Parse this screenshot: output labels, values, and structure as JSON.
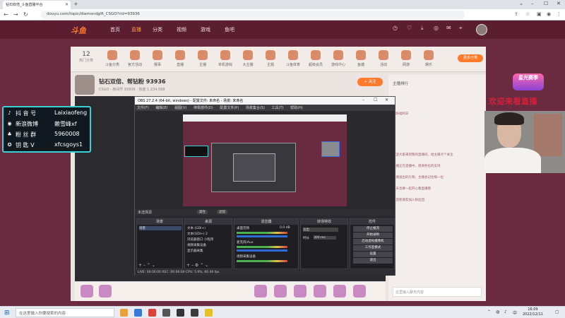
{
  "browser": {
    "tab_title": "钻石双倍_斗鱼直播平台",
    "url": "douyu.com/topic/diamondgift_CSGO?rid=93936"
  },
  "site": {
    "logo": "斗鱼",
    "nav": [
      "首页",
      "直播",
      "分类",
      "视频",
      "游戏",
      "鱼吧"
    ]
  },
  "category": {
    "count": "12",
    "count_label": "热门分类",
    "items": [
      "斗鱼分类",
      "官方活动",
      "赛事",
      "直播",
      "主播",
      "单机游戏",
      "大主播",
      "主题",
      "斗鱼体育",
      "超级会员",
      "游戏中心",
      "鱼塘",
      "活动",
      "网游",
      "娱乐"
    ],
    "button": "更多分类"
  },
  "streamer": {
    "title": "钻石双倍、帮钻粉 93936",
    "sub": "CSGO  · 房间号 93936  · 热度 1,234,568",
    "follow": "+ 关注"
  },
  "sidebar": {
    "rank_label": "主播排行",
    "chat_lines": [
      "钻粉福利日",
      "欢迎大家来到我的直播间，给主播点个关注",
      "主播正在直播中，感谢各位的支持",
      "感谢送出的礼物，主播会记住每一位",
      "今天也要一起开心看直播哦",
      "欢迎新朋友加入粉丝团"
    ],
    "input_placeholder": "这里输入聊天内容"
  },
  "promo": {
    "text": "星光赛季"
  },
  "overlay_red": "欢迎来看直播",
  "social": {
    "rows": [
      {
        "icon": "douyin-icon",
        "label": "抖 音 号",
        "value": "Laixiaofeng"
      },
      {
        "icon": "weibo-icon",
        "label": "新浪微博",
        "value": "赖雪峰xf"
      },
      {
        "icon": "fans-icon",
        "label": "粉 丝 群",
        "value": "5960008"
      },
      {
        "icon": "key-icon",
        "label": "钥 匙 V",
        "value": "xfcsgoys1"
      }
    ]
  },
  "obs": {
    "title": "OBS 27.2.4 (64-bit, windows) - 配置文件: 未命名 - 场景: 未命名",
    "menu": [
      "文件(F)",
      "编辑(E)",
      "视图(V)",
      "停靠部件(D)",
      "配置文件(P)",
      "场景集合(S)",
      "工具(T)",
      "帮助(H)"
    ],
    "status_text": "未选择源",
    "btn_props": "属性",
    "btn_filters": "滤镜",
    "docks": {
      "scenes": {
        "title": "场景",
        "items": [
          "场景"
        ]
      },
      "sources": {
        "title": "来源",
        "items": [
          "文本 (GDI+)",
          "文本(GDI+) 2",
          "浏览器窗口 小程序",
          "视频采集设备",
          "显示器采集"
        ]
      },
      "mixer": {
        "title": "混音器",
        "items": [
          "桌面音频",
          "麦克风/Aux",
          "视频采集设备"
        ],
        "db": "0.0 dB"
      },
      "transitions": {
        "title": "转场特效",
        "mode": "淡出",
        "duration_label": "时长",
        "duration": "300 ms"
      },
      "controls": {
        "title": "控件",
        "buttons": [
          "停止推流",
          "开始录制",
          "启动虚拟摄像机",
          "工作室模式",
          "设置",
          "退出"
        ]
      }
    },
    "footer": "LIVE: 00:00:00   REC: 00:00:00   CPU: 5.9%, 60.00 fps"
  },
  "taskbar": {
    "search_placeholder": "在这里输入你要搜索的内容",
    "time": "16:09",
    "date": "2022/12/11"
  }
}
